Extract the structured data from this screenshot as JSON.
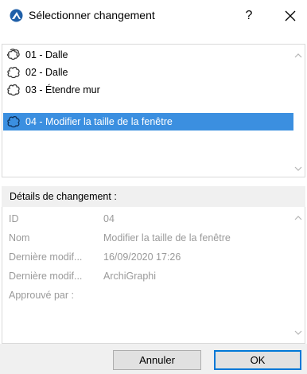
{
  "window": {
    "title": "Sélectionner changement",
    "help_label": "?"
  },
  "changes": [
    {
      "label": "01 - Dalle",
      "icon": "cloud-multi-icon",
      "selected": false
    },
    {
      "label": "02 - Dalle",
      "icon": "cloud-icon",
      "selected": false
    },
    {
      "label": "03 - Étendre mur",
      "icon": "cloud-icon",
      "selected": false
    },
    {
      "label": "04 - Modifier la taille de la fenêtre",
      "icon": "cloud-icon",
      "selected": true
    }
  ],
  "details": {
    "header": "Détails de changement :",
    "rows": [
      {
        "key": "ID",
        "value": "04"
      },
      {
        "key": "Nom",
        "value": "Modifier la taille de la fenêtre"
      },
      {
        "key": "Dernière modif...",
        "value": "16/09/2020 17:26"
      },
      {
        "key": "Dernière modif...",
        "value": "ArchiGraphi"
      },
      {
        "key": "Approuvé par :",
        "value": ""
      }
    ]
  },
  "buttons": {
    "cancel": "Annuler",
    "ok": "OK"
  },
  "colors": {
    "selection": "#3b8fe0",
    "default_button_border": "#0078d7",
    "muted_text": "#9a9a9a"
  }
}
